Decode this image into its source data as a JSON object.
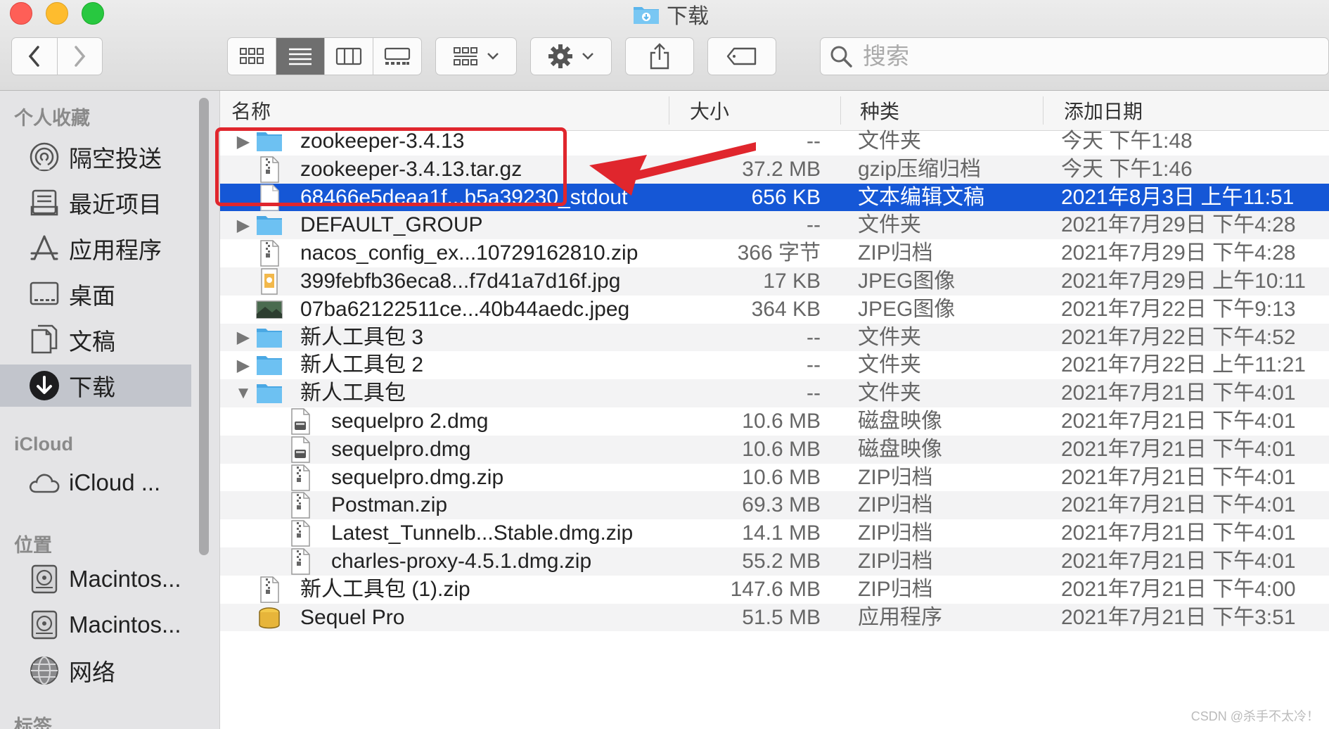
{
  "window": {
    "title": "下载"
  },
  "toolbar": {
    "back_icon": "chevron-left-icon",
    "forward_icon": "chevron-right-icon",
    "view_modes": [
      "icon-view",
      "list-view",
      "column-view",
      "gallery-view"
    ],
    "active_view": "list-view",
    "search_placeholder": "搜索"
  },
  "sidebar": {
    "sections": [
      {
        "header": "个人收藏",
        "items": [
          {
            "label": "隔空投送",
            "icon": "airdrop-icon"
          },
          {
            "label": "最近项目",
            "icon": "recents-icon"
          },
          {
            "label": "应用程序",
            "icon": "applications-icon"
          },
          {
            "label": "桌面",
            "icon": "desktop-icon"
          },
          {
            "label": "文稿",
            "icon": "documents-icon"
          },
          {
            "label": "下载",
            "icon": "downloads-icon",
            "selected": true
          }
        ]
      },
      {
        "header": "iCloud",
        "items": [
          {
            "label": "iCloud ...",
            "icon": "cloud-icon"
          }
        ]
      },
      {
        "header": "位置",
        "items": [
          {
            "label": "Macintos...",
            "icon": "disk-icon"
          },
          {
            "label": "Macintos...",
            "icon": "disk-icon"
          },
          {
            "label": "网络",
            "icon": "network-icon"
          }
        ]
      },
      {
        "header": "标签",
        "items": []
      }
    ]
  },
  "columns": {
    "name": "名称",
    "size": "大小",
    "kind": "种类",
    "date": "添加日期"
  },
  "files": [
    {
      "name": "zookeeper-3.4.13",
      "size": "--",
      "kind": "文件夹",
      "date": "今天 下午1:48",
      "type": "folder",
      "disclosure": "collapsed",
      "indent": 0
    },
    {
      "name": "zookeeper-3.4.13.tar.gz",
      "size": "37.2 MB",
      "kind": "gzip压缩归档",
      "date": "今天 下午1:46",
      "type": "archive",
      "indent": 0
    },
    {
      "name": "68466e5deaa1f...b5a39230_stdout",
      "size": "656 KB",
      "kind": "文本编辑文稿",
      "date": "2021年8月3日 上午11:51",
      "type": "doc",
      "indent": 0,
      "selected": true
    },
    {
      "name": "DEFAULT_GROUP",
      "size": "--",
      "kind": "文件夹",
      "date": "2021年7月29日 下午4:28",
      "type": "folder",
      "disclosure": "collapsed",
      "indent": 0
    },
    {
      "name": "nacos_config_ex...10729162810.zip",
      "size": "366 字节",
      "kind": "ZIP归档",
      "date": "2021年7月29日 下午4:28",
      "type": "archive",
      "indent": 0
    },
    {
      "name": "399febfb36eca8...f7d41a7d16f.jpg",
      "size": "17 KB",
      "kind": "JPEG图像",
      "date": "2021年7月29日 上午10:11",
      "type": "image",
      "indent": 0
    },
    {
      "name": "07ba62122511ce...40b44aedc.jpeg",
      "size": "364 KB",
      "kind": "JPEG图像",
      "date": "2021年7月22日 下午9:13",
      "type": "image2",
      "indent": 0
    },
    {
      "name": "新人工具包 3",
      "size": "--",
      "kind": "文件夹",
      "date": "2021年7月22日 下午4:52",
      "type": "folder",
      "disclosure": "collapsed",
      "indent": 0
    },
    {
      "name": "新人工具包 2",
      "size": "--",
      "kind": "文件夹",
      "date": "2021年7月22日 上午11:21",
      "type": "folder",
      "disclosure": "collapsed",
      "indent": 0
    },
    {
      "name": "新人工具包",
      "size": "--",
      "kind": "文件夹",
      "date": "2021年7月21日 下午4:01",
      "type": "folder",
      "disclosure": "expanded",
      "indent": 0
    },
    {
      "name": "sequelpro 2.dmg",
      "size": "10.6 MB",
      "kind": "磁盘映像",
      "date": "2021年7月21日 下午4:01",
      "type": "dmg",
      "indent": 1
    },
    {
      "name": "sequelpro.dmg",
      "size": "10.6 MB",
      "kind": "磁盘映像",
      "date": "2021年7月21日 下午4:01",
      "type": "dmg",
      "indent": 1
    },
    {
      "name": "sequelpro.dmg.zip",
      "size": "10.6 MB",
      "kind": "ZIP归档",
      "date": "2021年7月21日 下午4:01",
      "type": "archive",
      "indent": 1
    },
    {
      "name": "Postman.zip",
      "size": "69.3 MB",
      "kind": "ZIP归档",
      "date": "2021年7月21日 下午4:01",
      "type": "archive",
      "indent": 1
    },
    {
      "name": "Latest_Tunnelb...Stable.dmg.zip",
      "size": "14.1 MB",
      "kind": "ZIP归档",
      "date": "2021年7月21日 下午4:01",
      "type": "archive",
      "indent": 1
    },
    {
      "name": "charles-proxy-4.5.1.dmg.zip",
      "size": "55.2 MB",
      "kind": "ZIP归档",
      "date": "2021年7月21日 下午4:01",
      "type": "archive",
      "indent": 1
    },
    {
      "name": "新人工具包 (1).zip",
      "size": "147.6 MB",
      "kind": "ZIP归档",
      "date": "2021年7月21日 下午4:00",
      "type": "archive",
      "indent": 0
    },
    {
      "name": "Sequel Pro",
      "size": "51.5 MB",
      "kind": "应用程序",
      "date": "2021年7月21日 下午3:51",
      "type": "app",
      "indent": 0
    }
  ],
  "annotation": {
    "color": "#e0262d"
  },
  "watermark": "CSDN @杀手不太冷！",
  "colors": {
    "selection": "#1557d6",
    "sidebar_bg": "#e4e4e6",
    "folder": "#5ab5ec"
  }
}
